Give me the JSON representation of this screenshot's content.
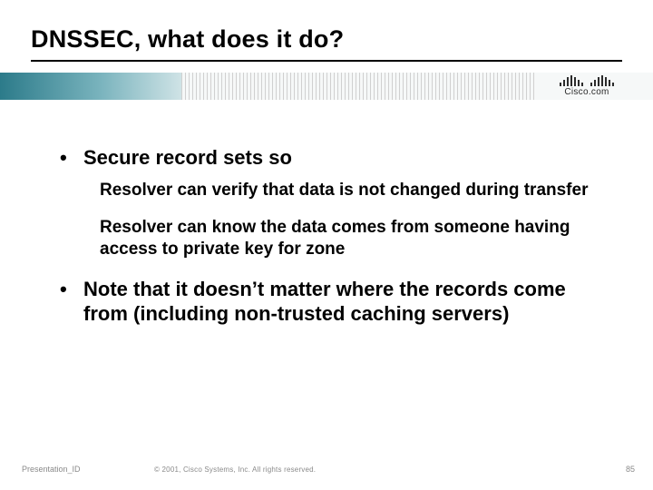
{
  "title": "DNSSEC, what does it do?",
  "logo": {
    "text": "Cisco.com"
  },
  "bullets": [
    {
      "text": "Secure record sets so",
      "subs": [
        "Resolver can verify that data is not changed during transfer",
        "Resolver can know the data comes from someone having access to private key for zone"
      ]
    },
    {
      "text": "Note that it doesn’t matter where the records come from (including non-trusted caching servers)",
      "subs": []
    }
  ],
  "footer": {
    "presentation_id": "Presentation_ID",
    "copyright": "© 2001, Cisco Systems, Inc. All rights reserved.",
    "page": "85"
  }
}
